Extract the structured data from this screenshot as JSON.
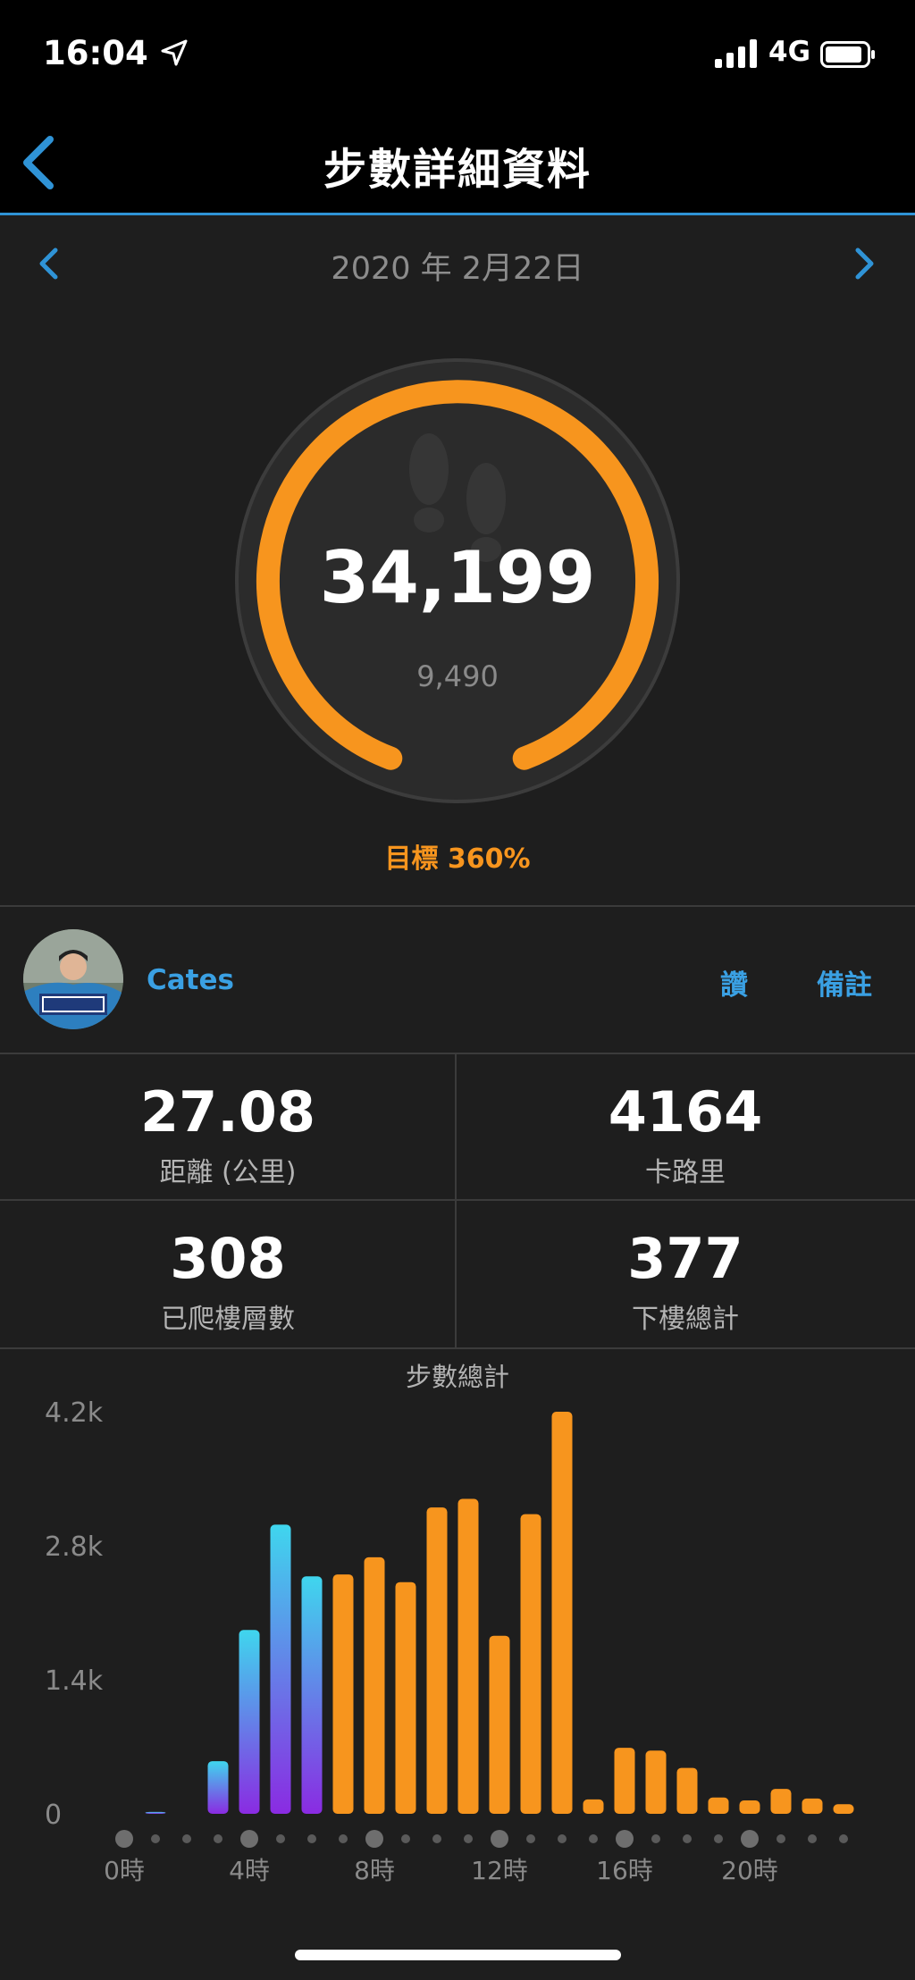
{
  "status_bar": {
    "time": "16:04",
    "network": "4G"
  },
  "header": {
    "title": "步數詳細資料"
  },
  "date_nav": {
    "date": "2020 年 2月22日"
  },
  "ring": {
    "steps": "34,199",
    "sub_value": "9,490",
    "goal_text": "目標 360%",
    "progress_percent": 360
  },
  "profile": {
    "name": "Cates",
    "like_label": "讚",
    "note_label": "備註"
  },
  "stats": [
    {
      "value": "27.08",
      "label": "距離 (公里)"
    },
    {
      "value": "4164",
      "label": "卡路里"
    },
    {
      "value": "308",
      "label": "已爬樓層數"
    },
    {
      "value": "377",
      "label": "下樓總計"
    }
  ],
  "colors": {
    "accent_orange": "#f7951e",
    "accent_blue": "#2f93d6",
    "gradient_cyan": "#3fd6ee",
    "gradient_purple": "#8a2be2"
  },
  "chart_data": {
    "type": "bar",
    "title": "步數總計",
    "yticks": [
      "4.2k",
      "2.8k",
      "1.4k",
      "0"
    ],
    "ylim": [
      0,
      4200
    ],
    "xticks": [
      {
        "hour": 0,
        "label": "0時"
      },
      {
        "hour": 4,
        "label": "4時"
      },
      {
        "hour": 8,
        "label": "8時"
      },
      {
        "hour": 12,
        "label": "12時"
      },
      {
        "hour": 16,
        "label": "16時"
      },
      {
        "hour": 20,
        "label": "20時"
      }
    ],
    "hours": [
      1,
      3,
      4,
      5,
      6,
      7,
      8,
      9,
      10,
      11,
      12,
      13,
      14,
      15,
      16,
      17,
      18,
      19,
      20,
      21,
      22,
      23
    ],
    "values": [
      20,
      550,
      1920,
      3020,
      2480,
      2500,
      2680,
      2420,
      3200,
      3290,
      1860,
      3130,
      4200,
      150,
      690,
      660,
      480,
      170,
      140,
      260,
      160,
      100
    ],
    "intensity": [
      "active",
      "active",
      "active",
      "active",
      "active",
      "highly_active",
      "highly_active",
      "highly_active",
      "highly_active",
      "highly_active",
      "highly_active",
      "highly_active",
      "highly_active",
      "highly_active",
      "highly_active",
      "highly_active",
      "highly_active",
      "highly_active",
      "highly_active",
      "highly_active",
      "highly_active",
      "highly_active"
    ]
  }
}
